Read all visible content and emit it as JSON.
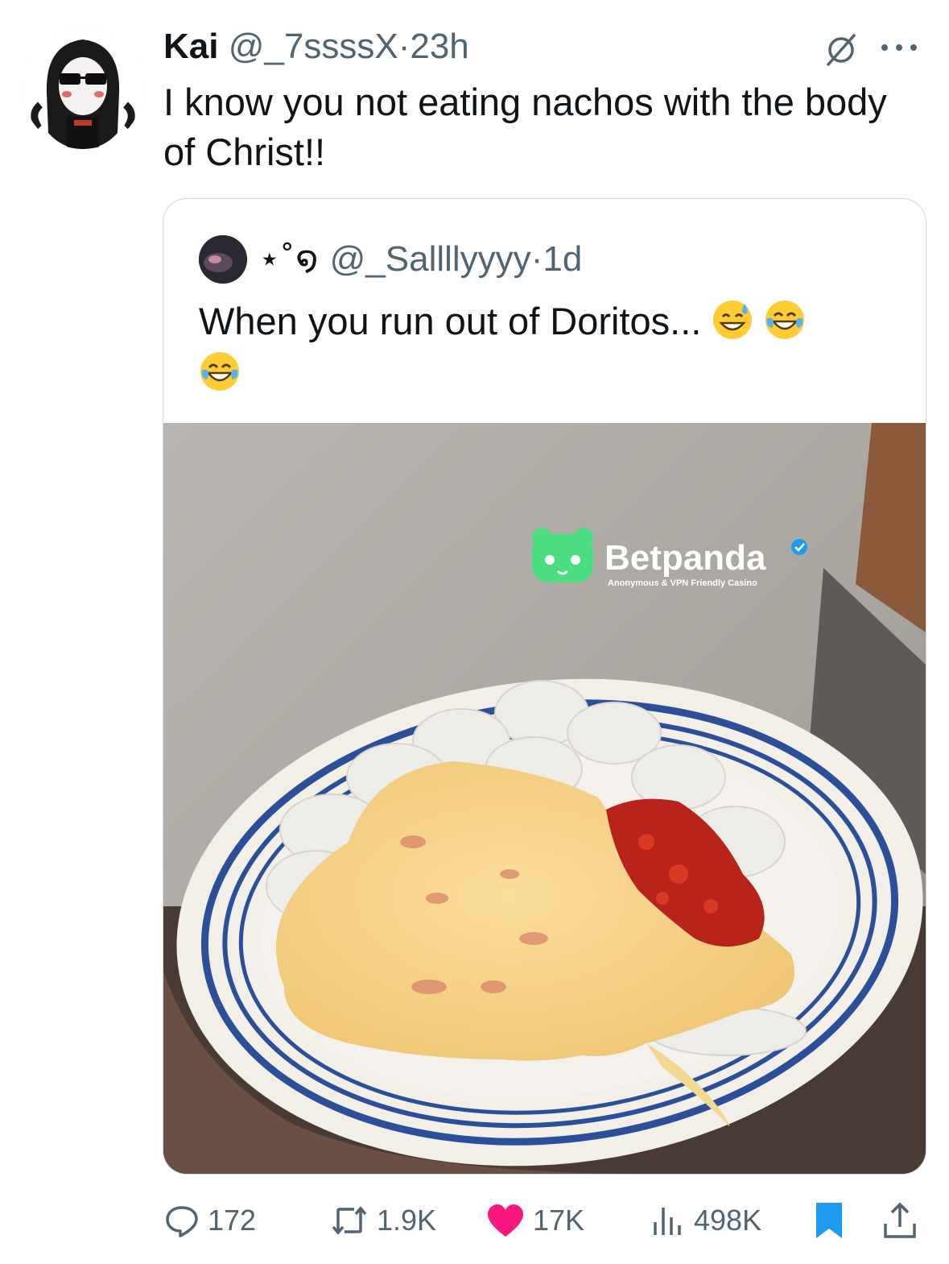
{
  "tweet": {
    "author_name": "Kai",
    "author_handle": "@_7ssssX",
    "separator": "·",
    "time": "23h",
    "text": "I know you not eating nachos with the body of Christ!!",
    "icons": [
      "grok-icon",
      "more-icon"
    ]
  },
  "quoted_tweet": {
    "display_name": "⋆˚໑",
    "handle": "@_Sallllyyyy",
    "separator": "·",
    "time": "1d",
    "text": "When you run out of Doritos...",
    "emojis": [
      "grinning-sweat-emoji",
      "tears-of-joy-emoji",
      "tears-of-joy-emoji"
    ],
    "image": {
      "description_icon": "photo-nachos-communion-wafers",
      "watermark_brand": "Betpanda",
      "watermark_tagline": "Anonymous & VPN Friendly Casino"
    }
  },
  "actions": {
    "replies": "172",
    "reposts": "1.9K",
    "likes": "17K",
    "views": "498K",
    "icons": [
      "reply-icon",
      "repost-icon",
      "like-icon",
      "views-icon",
      "bookmark-icon",
      "share-icon"
    ]
  },
  "colors": {
    "text_primary": "#0f1419",
    "text_secondary": "#536471",
    "like": "#f91880",
    "bookmark": "#1d9bf0",
    "verified": "#1d9bf0",
    "betpanda": "#4ade80"
  }
}
